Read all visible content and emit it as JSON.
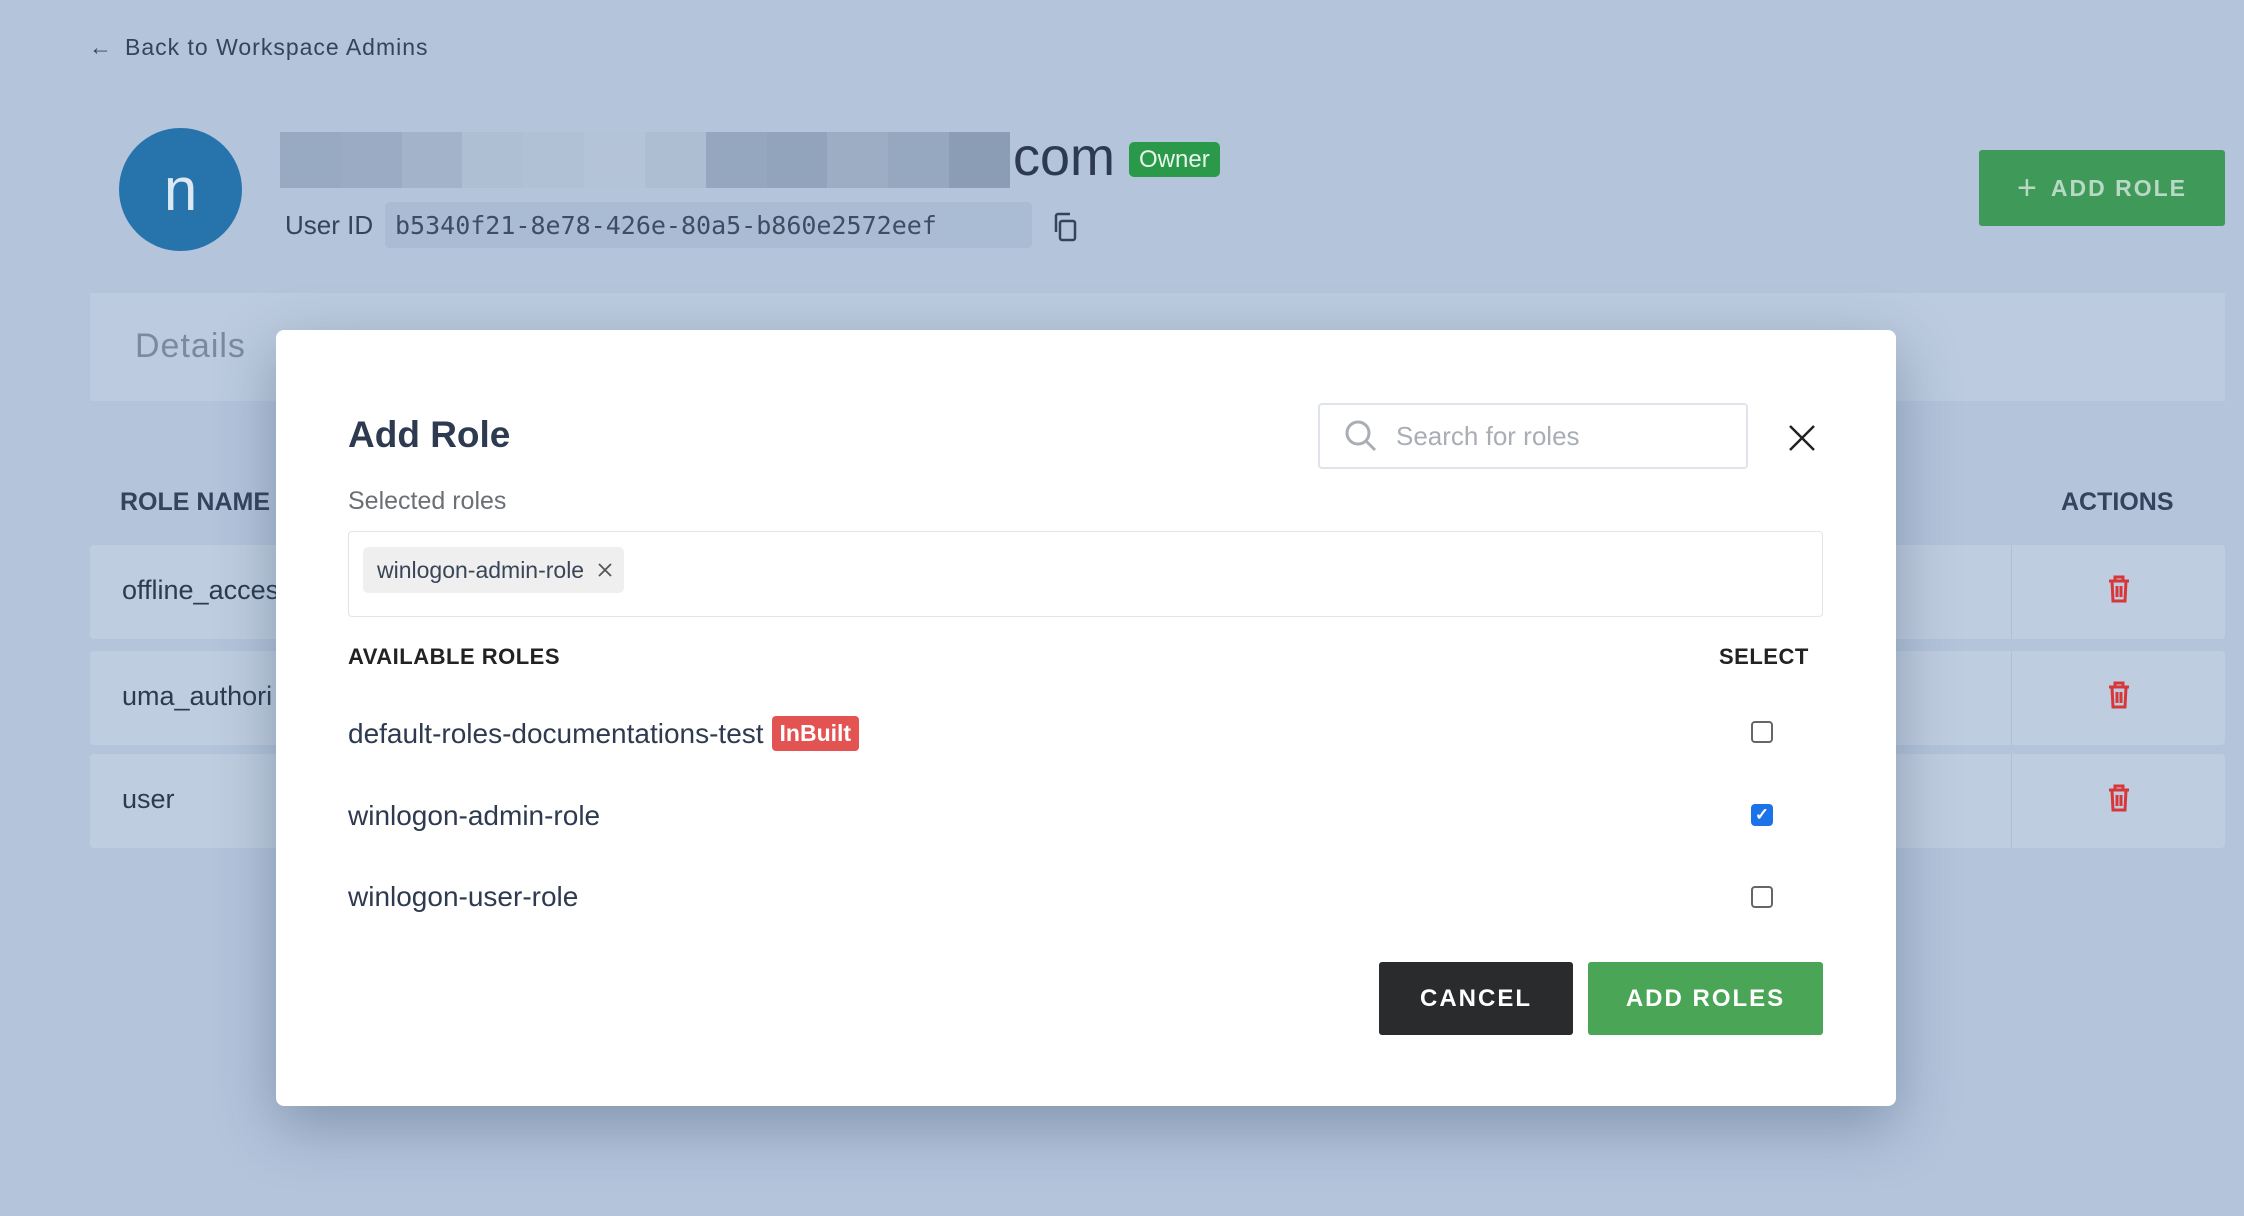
{
  "back_link": "Back to Workspace Admins",
  "user": {
    "avatar_letter": "n",
    "email_suffix": "com",
    "role_badge": "Owner",
    "user_id_label": "User ID",
    "user_id": "b5340f21-8e78-426e-80a5-b860e2572eef"
  },
  "add_role_button": "ADD ROLE",
  "tabs": {
    "details": "Details"
  },
  "table": {
    "headers": {
      "role_name": "ROLE NAME",
      "actions": "ACTIONS"
    },
    "rows": [
      {
        "name": "offline_acces"
      },
      {
        "name": "uma_authori"
      },
      {
        "name": "user"
      }
    ]
  },
  "modal": {
    "title": "Add Role",
    "search_placeholder": "Search for roles",
    "selected_label": "Selected roles",
    "selected": [
      "winlogon-admin-role"
    ],
    "available_header": "AVAILABLE ROLES",
    "select_header": "SELECT",
    "roles": [
      {
        "name": "default-roles-documentations-test",
        "badge": "InBuilt",
        "checked": false
      },
      {
        "name": "winlogon-admin-role",
        "checked": true
      },
      {
        "name": "winlogon-user-role",
        "checked": false
      }
    ],
    "cancel": "CANCEL",
    "add_roles": "ADD ROLES"
  },
  "colors": {
    "accent_green": "#4aa556",
    "owner_badge": "#2a9a4a",
    "inbuilt_badge": "#e35352",
    "trash": "#d8373a",
    "checkbox": "#1a73e8"
  }
}
